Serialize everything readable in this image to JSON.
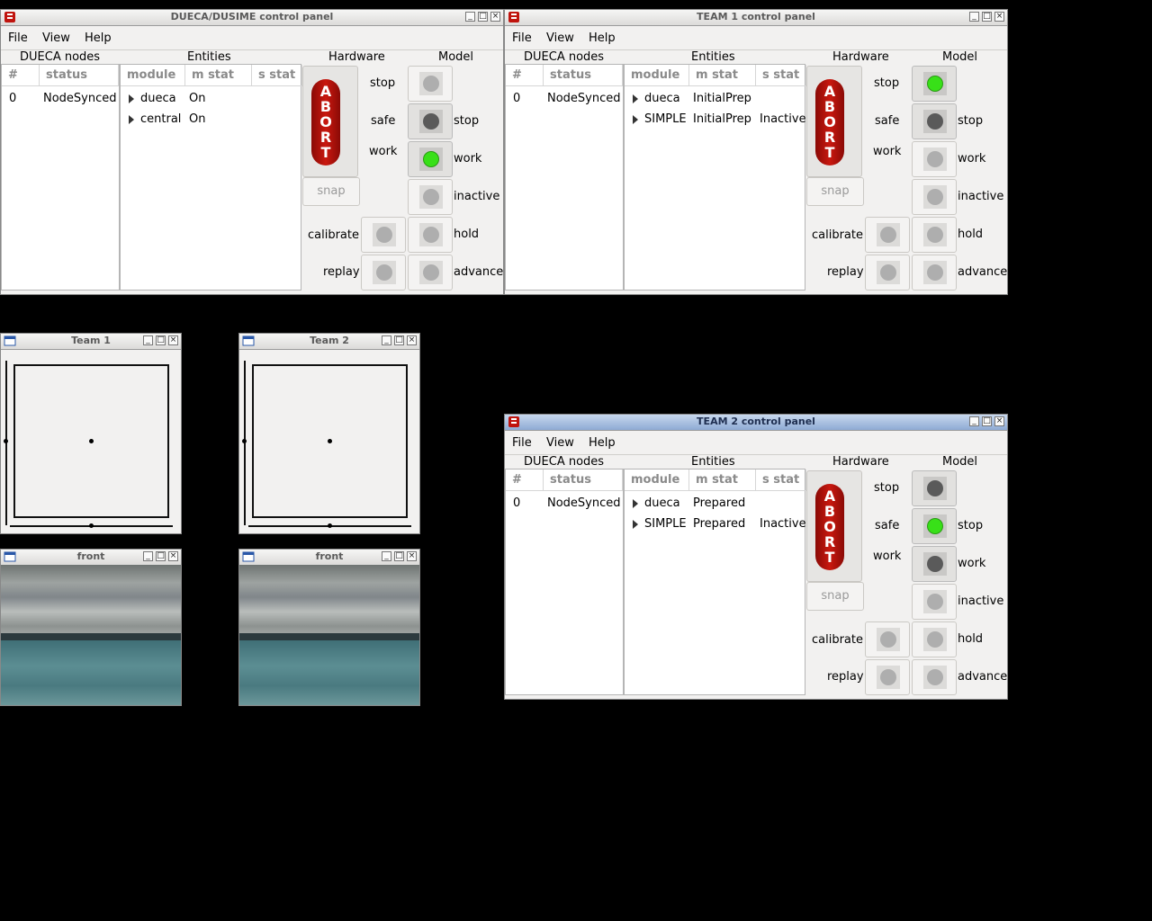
{
  "windows": {
    "main": {
      "title": "DUECA/DUSIME control panel",
      "menu": [
        "File",
        "View",
        "Help"
      ],
      "headers": {
        "nodes": "DUECA nodes",
        "entities": "Entities",
        "hardware": "Hardware",
        "model": "Model"
      },
      "node_cols": [
        "#",
        "status"
      ],
      "nodes": [
        {
          "id": "0",
          "status": "NodeSynced"
        }
      ],
      "entity_cols": [
        "module",
        "m stat",
        "s stat"
      ],
      "entities": [
        {
          "module": "dueca",
          "m_stat": "On",
          "s_stat": ""
        },
        {
          "module": "central",
          "m_stat": "On",
          "s_stat": ""
        }
      ],
      "abort_letters": [
        "A",
        "B",
        "O",
        "R",
        "T"
      ],
      "labels": {
        "stop": "stop",
        "safe": "safe",
        "work": "work",
        "snap": "snap",
        "calibrate": "calibrate",
        "replay": "replay"
      },
      "model_labels": {
        "stop": "stop",
        "work": "work",
        "inactive": "inactive",
        "hold": "hold",
        "advance": "advance"
      },
      "leds": {
        "stop": "off",
        "safe": "dark",
        "work": "green",
        "inactive": "off",
        "hold": "off",
        "advance": "off",
        "calibrate": "off",
        "replay": "off"
      }
    },
    "team1": {
      "title": "TEAM 1 control panel",
      "menu": [
        "File",
        "View",
        "Help"
      ],
      "headers": {
        "nodes": "DUECA nodes",
        "entities": "Entities",
        "hardware": "Hardware",
        "model": "Model"
      },
      "node_cols": [
        "#",
        "status"
      ],
      "nodes": [
        {
          "id": "0",
          "status": "NodeSynced"
        }
      ],
      "entity_cols": [
        "module",
        "m stat",
        "s stat"
      ],
      "entities": [
        {
          "module": "dueca",
          "m_stat": "InitialPrep",
          "s_stat": ""
        },
        {
          "module": "SIMPLE",
          "m_stat": "InitialPrep",
          "s_stat": "Inactive"
        }
      ],
      "abort_letters": [
        "A",
        "B",
        "O",
        "R",
        "T"
      ],
      "labels": {
        "stop": "stop",
        "safe": "safe",
        "work": "work",
        "snap": "snap",
        "calibrate": "calibrate",
        "replay": "replay"
      },
      "model_labels": {
        "stop": "stop",
        "work": "work",
        "inactive": "inactive",
        "hold": "hold",
        "advance": "advance"
      },
      "leds": {
        "stop": "green",
        "safe": "dark",
        "work": "off",
        "inactive": "off",
        "hold": "off",
        "advance": "off",
        "calibrate": "off",
        "replay": "off"
      }
    },
    "team2": {
      "title": "TEAM 2 control panel",
      "menu": [
        "File",
        "View",
        "Help"
      ],
      "headers": {
        "nodes": "DUECA nodes",
        "entities": "Entities",
        "hardware": "Hardware",
        "model": "Model"
      },
      "node_cols": [
        "#",
        "status"
      ],
      "nodes": [
        {
          "id": "0",
          "status": "NodeSynced"
        }
      ],
      "entity_cols": [
        "module",
        "m stat",
        "s stat"
      ],
      "entities": [
        {
          "module": "dueca",
          "m_stat": "Prepared",
          "s_stat": ""
        },
        {
          "module": "SIMPLE",
          "m_stat": "Prepared",
          "s_stat": "Inactive"
        }
      ],
      "abort_letters": [
        "A",
        "B",
        "O",
        "R",
        "T"
      ],
      "labels": {
        "stop": "stop",
        "safe": "safe",
        "work": "work",
        "snap": "snap",
        "calibrate": "calibrate",
        "replay": "replay"
      },
      "model_labels": {
        "stop": "stop",
        "work": "work",
        "inactive": "inactive",
        "hold": "hold",
        "advance": "advance"
      },
      "leds": {
        "stop": "dark",
        "safe": "green",
        "work": "dark",
        "inactive": "off",
        "hold": "off",
        "advance": "off",
        "calibrate": "off",
        "replay": "off"
      }
    }
  },
  "small_windows": {
    "plot1": {
      "title": "Team 1"
    },
    "plot2": {
      "title": "Team 2"
    },
    "view1": {
      "title": "front"
    },
    "view2": {
      "title": "front"
    }
  },
  "colors": {
    "abort": "#c9180f",
    "led_green": "#38e018",
    "led_dark": "#5a5a5a",
    "led_off": "#aeaeae"
  }
}
